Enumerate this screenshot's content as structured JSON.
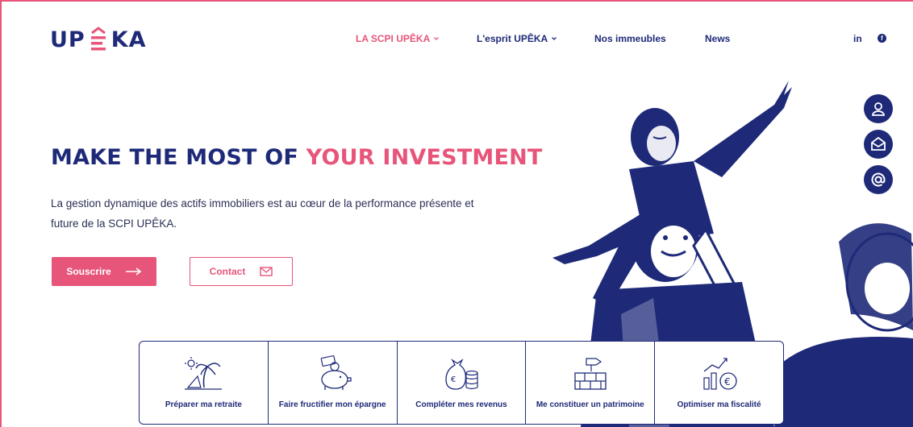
{
  "brand": {
    "logo_left": "UP",
    "logo_right": "KA",
    "primary_color": "#1e2a78",
    "accent_color": "#e7557a"
  },
  "nav": {
    "items": [
      {
        "label": "LA SCPI UPÊKA",
        "active": true,
        "dropdown": true
      },
      {
        "label": "L'esprit UPÊKA",
        "active": false,
        "dropdown": true
      },
      {
        "label": "Nos immeubles",
        "active": false,
        "dropdown": false
      },
      {
        "label": "News",
        "active": false,
        "dropdown": false
      }
    ],
    "social": {
      "linkedin": "in",
      "facebook": "f"
    }
  },
  "hero": {
    "headline_main": "MAKE THE MOST OF ",
    "headline_highlight": "YOUR INVESTMENT",
    "lead": "La gestion dynamique des actifs immobiliers est au cœur de la performance présente et future de la SCPI UPÊKA.",
    "primary_button": "Souscrire",
    "secondary_button": "Contact"
  },
  "side_icons": [
    "user-icon",
    "mail-open-icon",
    "at-sign-icon"
  ],
  "cards": [
    {
      "label": "Préparer ma retraite",
      "icon": "beach-palm-icon"
    },
    {
      "label": "Faire fructifier mon épargne",
      "icon": "piggy-bank-icon"
    },
    {
      "label": "Compléter mes revenus",
      "icon": "money-bag-icon"
    },
    {
      "label": "Me constituer un patrimoine",
      "icon": "bricks-icon"
    },
    {
      "label": "Optimiser ma fiscalité",
      "icon": "growth-chart-euro-icon"
    }
  ]
}
